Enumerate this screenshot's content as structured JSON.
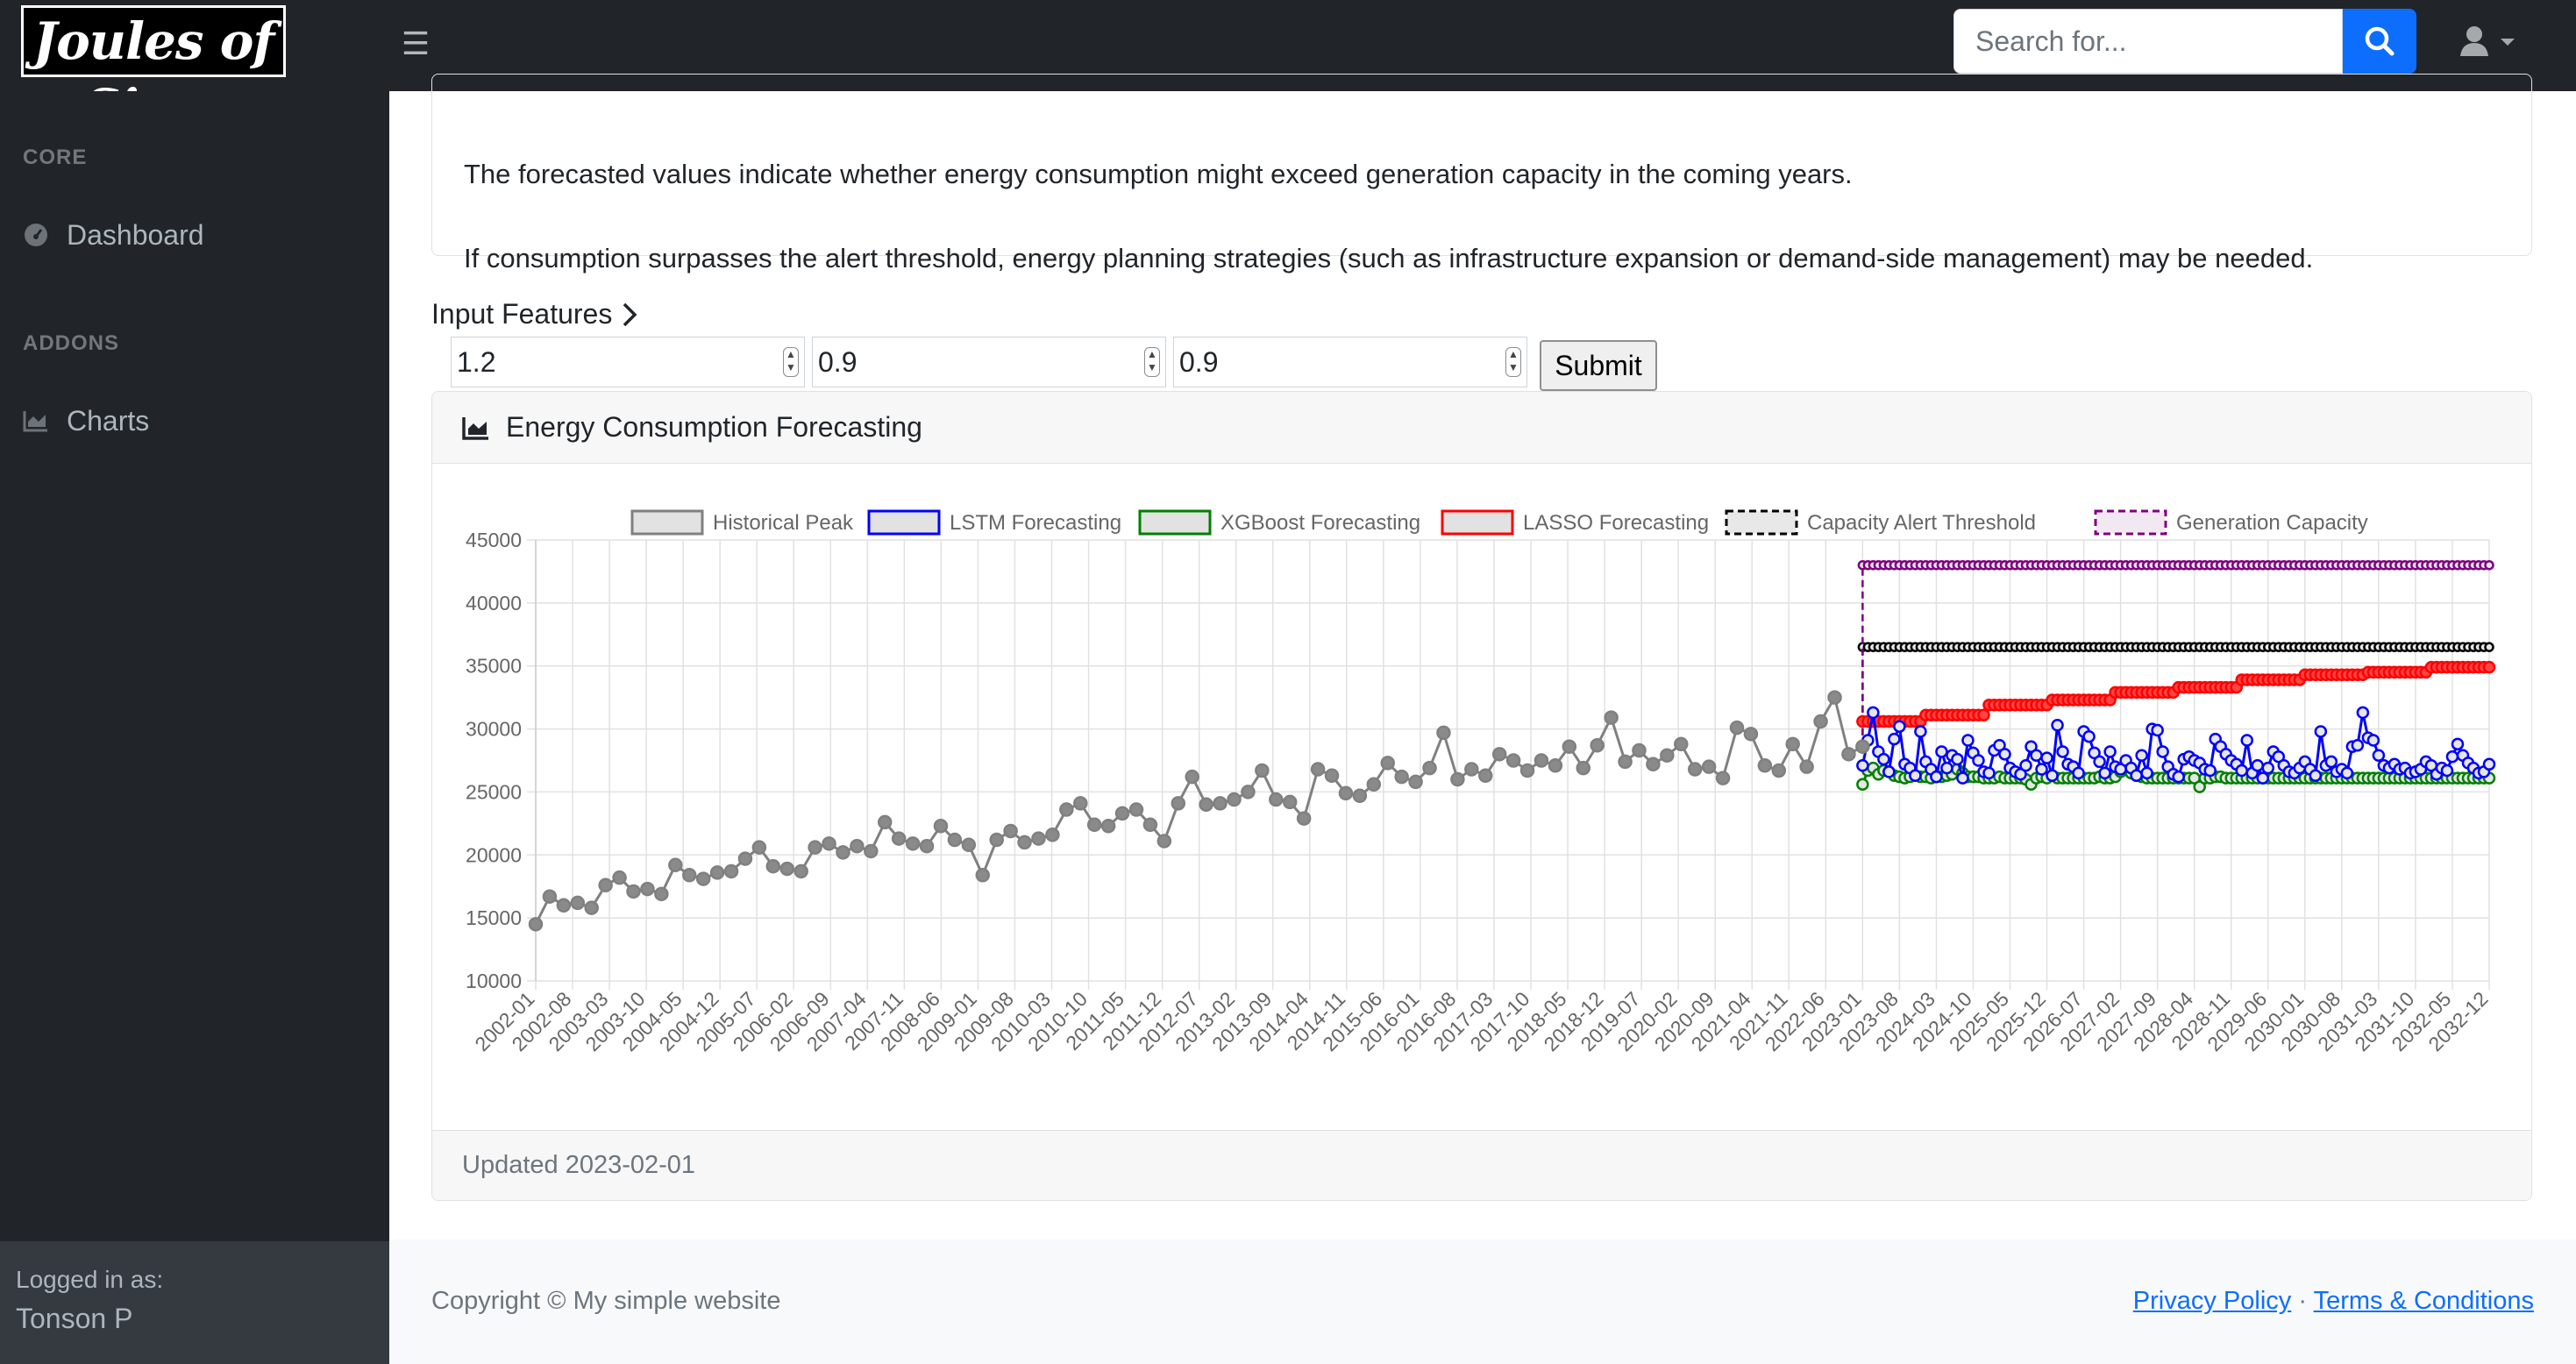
{
  "navbar": {
    "brand": "Joules of Siam",
    "search_placeholder": "Search for..."
  },
  "sidebar": {
    "core_heading": "CORE",
    "dashboard_label": "Dashboard",
    "addons_heading": "ADDONS",
    "charts_label": "Charts",
    "footer_small": "Logged in as:",
    "footer_user": "Tonson P"
  },
  "info": {
    "line1": "The forecasted values indicate whether energy consumption might exceed generation capacity in the coming years.",
    "line2": "If consumption surpasses the alert threshold, energy planning strategies (such as infrastructure expansion or demand-side management) may be needed."
  },
  "inputs": {
    "label": "Input Features",
    "values": [
      "1.2",
      "0.9",
      "0.9"
    ],
    "submit_label": "Submit"
  },
  "chart_card": {
    "title": "Energy Consumption Forecasting",
    "updated": "Updated 2023-02-01"
  },
  "chart_data": {
    "type": "line",
    "ylim": [
      10000,
      45000
    ],
    "yticks": [
      10000,
      15000,
      20000,
      25000,
      30000,
      35000,
      40000,
      45000
    ],
    "grid": true,
    "legend_position": "top",
    "xlabels": [
      "2002-01",
      "2002-08",
      "2003-03",
      "2003-10",
      "2004-05",
      "2004-12",
      "2005-07",
      "2006-02",
      "2006-09",
      "2007-04",
      "2007-11",
      "2008-06",
      "2009-01",
      "2009-08",
      "2010-03",
      "2010-10",
      "2011-05",
      "2011-12",
      "2012-07",
      "2013-02",
      "2013-09",
      "2014-04",
      "2014-11",
      "2015-06",
      "2016-01",
      "2016-08",
      "2017-03",
      "2017-10",
      "2018-05",
      "2018-12",
      "2019-07",
      "2020-02",
      "2020-09",
      "2021-04",
      "2021-11",
      "2022-06",
      "2023-01",
      "2023-08",
      "2024-03",
      "2024-10",
      "2025-05",
      "2025-12",
      "2026-07",
      "2027-02",
      "2027-09",
      "2028-04",
      "2028-11",
      "2029-06",
      "2030-01",
      "2030-08",
      "2031-03",
      "2031-10",
      "2032-05",
      "2032-12"
    ],
    "series": [
      {
        "name": "Historical Peak",
        "color": "#808080",
        "x_range": [
          "2002-01",
          "2023-01"
        ],
        "values": [
          14500,
          16700,
          16000,
          16200,
          15800,
          17600,
          18200,
          17100,
          17300,
          16900,
          19200,
          18400,
          18100,
          18600,
          18700,
          19700,
          20600,
          19100,
          18900,
          18700,
          20600,
          20900,
          20200,
          20700,
          20300,
          22600,
          21300,
          20900,
          20700,
          22300,
          21200,
          20800,
          18400,
          21200,
          21900,
          21000,
          21300,
          21600,
          23600,
          24100,
          22400,
          22300,
          23300,
          23600,
          22400,
          21100,
          24100,
          26200,
          24000,
          24100,
          24400,
          25000,
          26700,
          24400,
          24200,
          22900,
          26800,
          26300,
          24900,
          24700,
          25600,
          27300,
          26200,
          25800,
          26900,
          29700,
          26000,
          26800,
          26300,
          28000,
          27500,
          26700,
          27500,
          27100,
          28600,
          26900,
          28700,
          30900,
          27400,
          28300,
          27200,
          27900,
          28800,
          26800,
          27000,
          26100,
          30100,
          29600,
          27100,
          26700,
          28800,
          27000,
          30600,
          32500,
          28000,
          28600
        ]
      },
      {
        "name": "LSTM Forecasting",
        "color": "#0000ff",
        "x_range": [
          "2023-01",
          "2032-12"
        ],
        "values": [
          27100,
          29100,
          31300,
          28200,
          27600,
          26600,
          29200,
          30200,
          27200,
          26900,
          26300,
          29800,
          27400,
          26800,
          26200,
          28200,
          26900,
          27900,
          27600,
          26100,
          29100,
          28100,
          27500,
          26600,
          26500,
          28300,
          28700,
          28000,
          26900,
          26600,
          26400,
          27100,
          28600,
          27900,
          26800,
          27700,
          26300,
          30300,
          28200,
          27200,
          27000,
          26500,
          29800,
          29400,
          28100,
          27400,
          26500,
          28200,
          27000,
          26800,
          27500,
          26900,
          26300,
          27900,
          26500,
          30000,
          29900,
          28200,
          27000,
          26400,
          26200,
          27600,
          27800,
          27500,
          27300,
          26800,
          26700,
          29200,
          28600,
          28000,
          27500,
          27200,
          26700,
          29100,
          26500,
          27100,
          26100,
          26900,
          28200,
          27800,
          27100,
          26600,
          26500,
          26900,
          27400,
          26800,
          26300,
          29800,
          27100,
          27400,
          26600,
          26800,
          26500,
          28600,
          28700,
          31300,
          29300,
          29100,
          27900,
          27100,
          26900,
          27200,
          26800,
          26900,
          26500,
          26600,
          26800,
          27400,
          27100,
          26400,
          26900,
          26700,
          27800,
          28800,
          27900,
          27300,
          26900,
          26500,
          26600,
          27200
        ]
      },
      {
        "name": "XGBoost Forecasting",
        "color": "#008000",
        "x_range": [
          "2023-01",
          "2032-12"
        ],
        "values": [
          25600,
          26700,
          26900,
          26400,
          26700,
          26600,
          26300,
          26200,
          26100,
          26200,
          26300,
          26200,
          26200,
          26100,
          26200,
          26200,
          26300,
          26400,
          26800,
          26500,
          26200,
          26200,
          26200,
          26100,
          26100,
          26100,
          26200,
          26100,
          26100,
          26100,
          26100,
          26000,
          25600,
          26100,
          26200,
          26100,
          26300,
          26100,
          26100,
          26100,
          26100,
          26100,
          26100,
          26100,
          26100,
          26200,
          26100,
          26100,
          26200,
          26600,
          26800,
          26500,
          26300,
          26200,
          26100,
          26100,
          26100,
          26100,
          26100,
          26100,
          26100,
          26100,
          26100,
          26100,
          25400,
          26100,
          26100,
          26200,
          26200,
          26100,
          26100,
          26100,
          26100,
          26100,
          26100,
          26100,
          26100,
          26100,
          26100,
          26100,
          26100,
          26100,
          26100,
          26100,
          26100,
          26100,
          26100,
          26100,
          26100,
          26100,
          26100,
          26100,
          26100,
          26100,
          26100,
          26100,
          26100,
          26100,
          26100,
          26100,
          26100,
          26100,
          26100,
          26100,
          26100,
          26100,
          26100,
          26100,
          26100,
          26100,
          26100,
          26100,
          26100,
          26100,
          26100,
          26100,
          26100,
          26100,
          26100,
          26100
        ]
      },
      {
        "name": "LASSO Forecasting",
        "color": "#ff0000",
        "x_range": [
          "2023-01",
          "2032-12"
        ],
        "values": [
          30600,
          30600,
          30600,
          30600,
          30600,
          30600,
          30600,
          30600,
          30600,
          30600,
          30600,
          30600,
          31100,
          31100,
          31100,
          31100,
          31100,
          31100,
          31100,
          31100,
          31100,
          31100,
          31100,
          31100,
          31900,
          31900,
          31900,
          31900,
          31900,
          31900,
          31900,
          31900,
          31900,
          31900,
          31900,
          31900,
          32300,
          32300,
          32300,
          32300,
          32300,
          32300,
          32300,
          32300,
          32300,
          32300,
          32300,
          32300,
          32900,
          32900,
          32900,
          32900,
          32900,
          32900,
          32900,
          32900,
          32900,
          32900,
          32900,
          32900,
          33300,
          33300,
          33300,
          33300,
          33300,
          33300,
          33300,
          33300,
          33300,
          33300,
          33300,
          33300,
          33900,
          33900,
          33900,
          33900,
          33900,
          33900,
          33900,
          33900,
          33900,
          33900,
          33900,
          33900,
          34300,
          34300,
          34300,
          34300,
          34300,
          34300,
          34300,
          34300,
          34300,
          34300,
          34300,
          34300,
          34500,
          34500,
          34500,
          34500,
          34500,
          34500,
          34500,
          34500,
          34500,
          34500,
          34500,
          34500,
          34900,
          34900,
          34900,
          34900,
          34900,
          34900,
          34900,
          34900,
          34900,
          34900,
          34900,
          34900
        ]
      },
      {
        "name": "Capacity Alert Threshold",
        "color": "#000000",
        "dashed": true,
        "x_range": [
          "2023-01",
          "2032-12"
        ],
        "constant": 36500
      },
      {
        "name": "Generation Capacity",
        "color": "#800080",
        "dashed": true,
        "x_range": [
          "2023-01",
          "2032-12"
        ],
        "constant": 43000
      }
    ]
  },
  "footer": {
    "copyright": "Copyright © My simple website",
    "privacy": "Privacy Policy",
    "separator": "·",
    "terms": "Terms & Conditions"
  }
}
